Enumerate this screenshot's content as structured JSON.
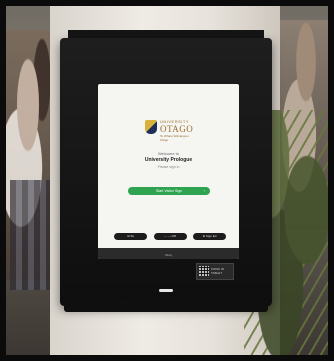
{
  "screen": {
    "logo": {
      "small_text": "UNIVERSITY",
      "name": "OTAGO",
      "maori": "Te Whare Wānanga o Otāgo"
    },
    "welcome_text": "Welcome to",
    "place_name": "University Prologue",
    "sub_text": "Please sign in",
    "visit_button": {
      "label": "Start Visitor Sign",
      "arrow": "›"
    },
    "options": [
      {
        "label": "⊞ Sit"
      },
      {
        "label": "⋯ — DR"
      },
      {
        "label": "⊕ Sign Ed"
      }
    ],
    "footer_text": "Sitely"
  },
  "sticker": {
    "text": "KIOSK ID\nTABLET"
  },
  "colors": {
    "green_button": "#2fa34f",
    "logo_gold": "#9b6b2c",
    "bezel": "#111111"
  }
}
